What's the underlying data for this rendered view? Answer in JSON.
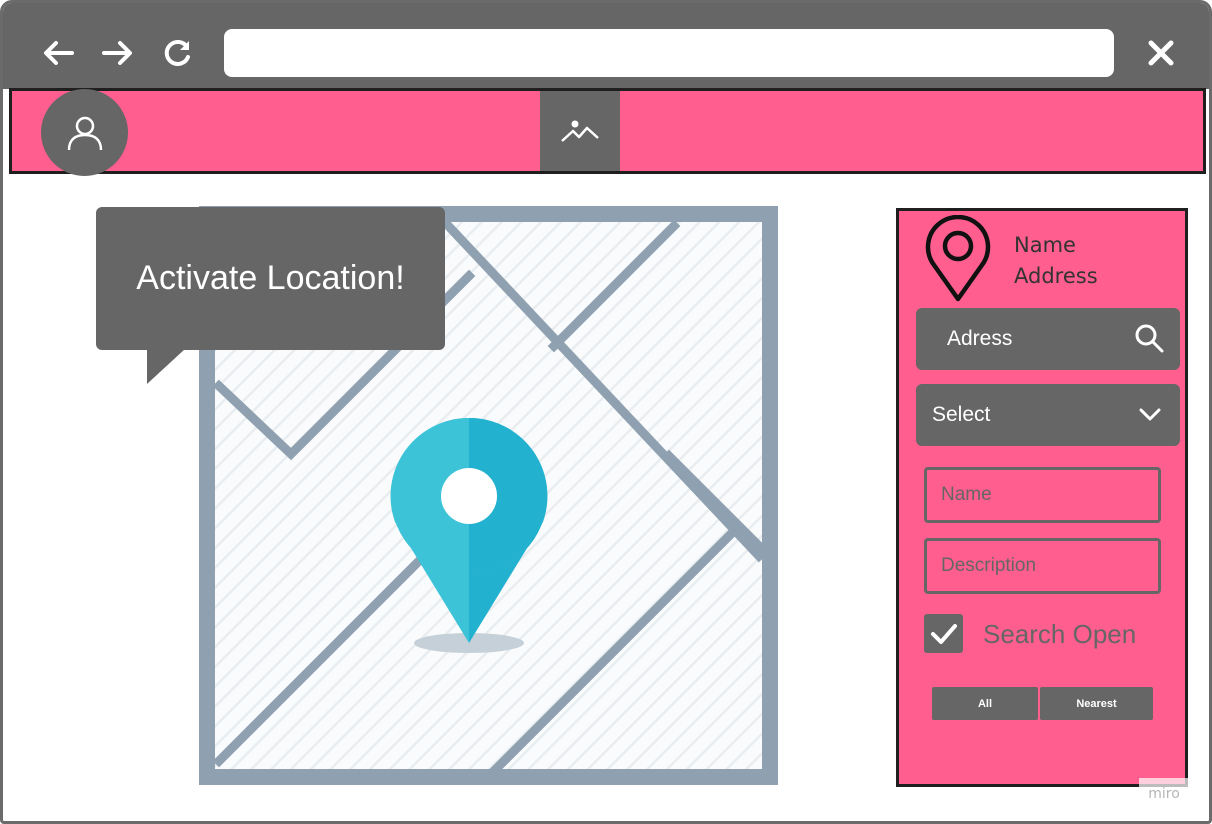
{
  "browser": {
    "back_icon": "arrow-left-icon",
    "forward_icon": "arrow-right-icon",
    "reload_icon": "reload-icon",
    "close_icon": "close-icon",
    "url_value": ""
  },
  "header": {
    "avatar_icon": "user-icon",
    "image_icon": "image-icon",
    "color": "#ff5e8f"
  },
  "tooltip": {
    "text": "Activate Location!"
  },
  "panel": {
    "info": {
      "name": "Name",
      "address": "Address"
    },
    "search": {
      "label": "Adress"
    },
    "select": {
      "label": "Select"
    },
    "fields": {
      "name_placeholder": "Name",
      "description_placeholder": "Description"
    },
    "checkbox": {
      "label": "Search Open",
      "checked": true
    },
    "segments": [
      {
        "label": "All"
      },
      {
        "label": "Nearest"
      }
    ]
  },
  "watermark": {
    "text": "miro"
  },
  "colors": {
    "accent": "#ff5e8f",
    "control": "#666666",
    "pin": "#28b7d1"
  }
}
